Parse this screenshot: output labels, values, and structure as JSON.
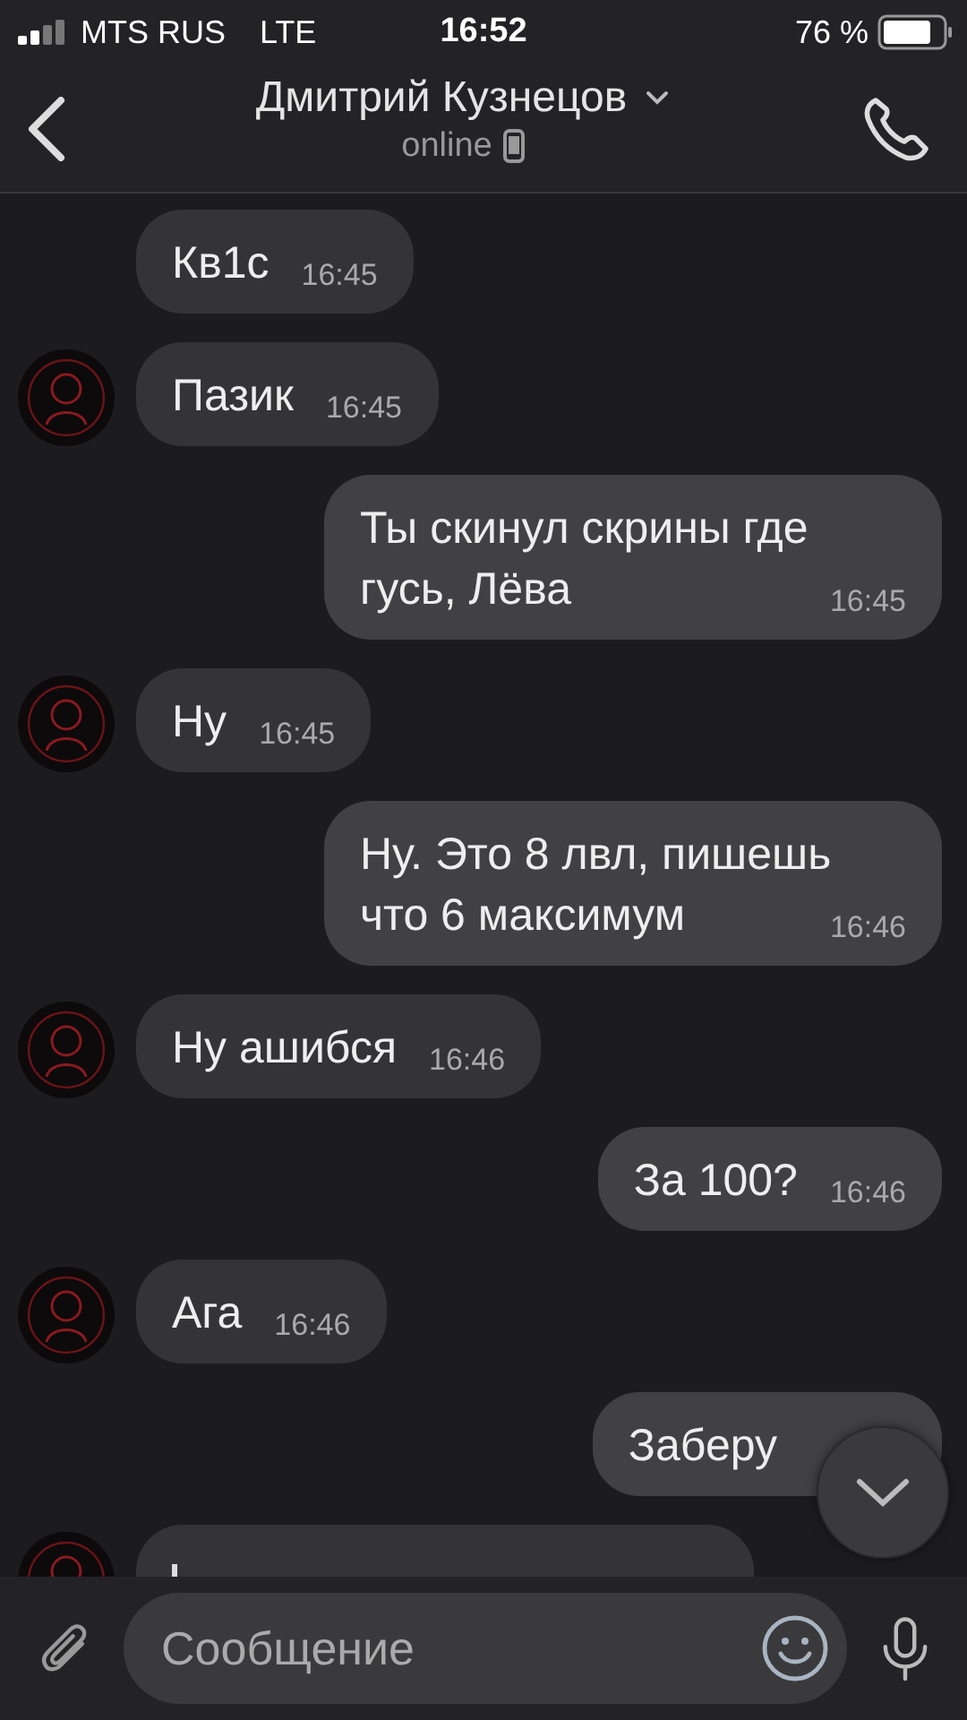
{
  "status_bar": {
    "carrier": "MTS RUS",
    "network": "LTE",
    "time": "16:52",
    "battery": "76 %"
  },
  "header": {
    "title": "Дмитрий Кузнецов",
    "status": "online"
  },
  "messages": [
    {
      "kind": "text",
      "outgoing": false,
      "avatar": false,
      "text": "Кв1с",
      "time": "16:45"
    },
    {
      "kind": "text",
      "outgoing": false,
      "avatar": true,
      "text": "Пазик",
      "time": "16:45"
    },
    {
      "kind": "text",
      "outgoing": true,
      "text": "Ты скинул скрины где гусь, Лёва",
      "time": "16:45"
    },
    {
      "kind": "text",
      "outgoing": false,
      "avatar": true,
      "text": "Ну",
      "time": "16:45"
    },
    {
      "kind": "text",
      "outgoing": true,
      "text": "Ну. Это 8 лвл, пишешь что 6 максимум",
      "time": "16:46"
    },
    {
      "kind": "text",
      "outgoing": false,
      "avatar": true,
      "text": "Ну ашибся",
      "time": "16:46"
    },
    {
      "kind": "text",
      "outgoing": true,
      "text": "За 100?",
      "time": "16:46"
    },
    {
      "kind": "text",
      "outgoing": false,
      "avatar": true,
      "text": "Ага",
      "time": "16:46"
    },
    {
      "kind": "text",
      "outgoing": true,
      "text": "Заберу"
    },
    {
      "kind": "reply",
      "outgoing": false,
      "avatar": true
    }
  ],
  "composer": {
    "placeholder": "Сообщение"
  }
}
